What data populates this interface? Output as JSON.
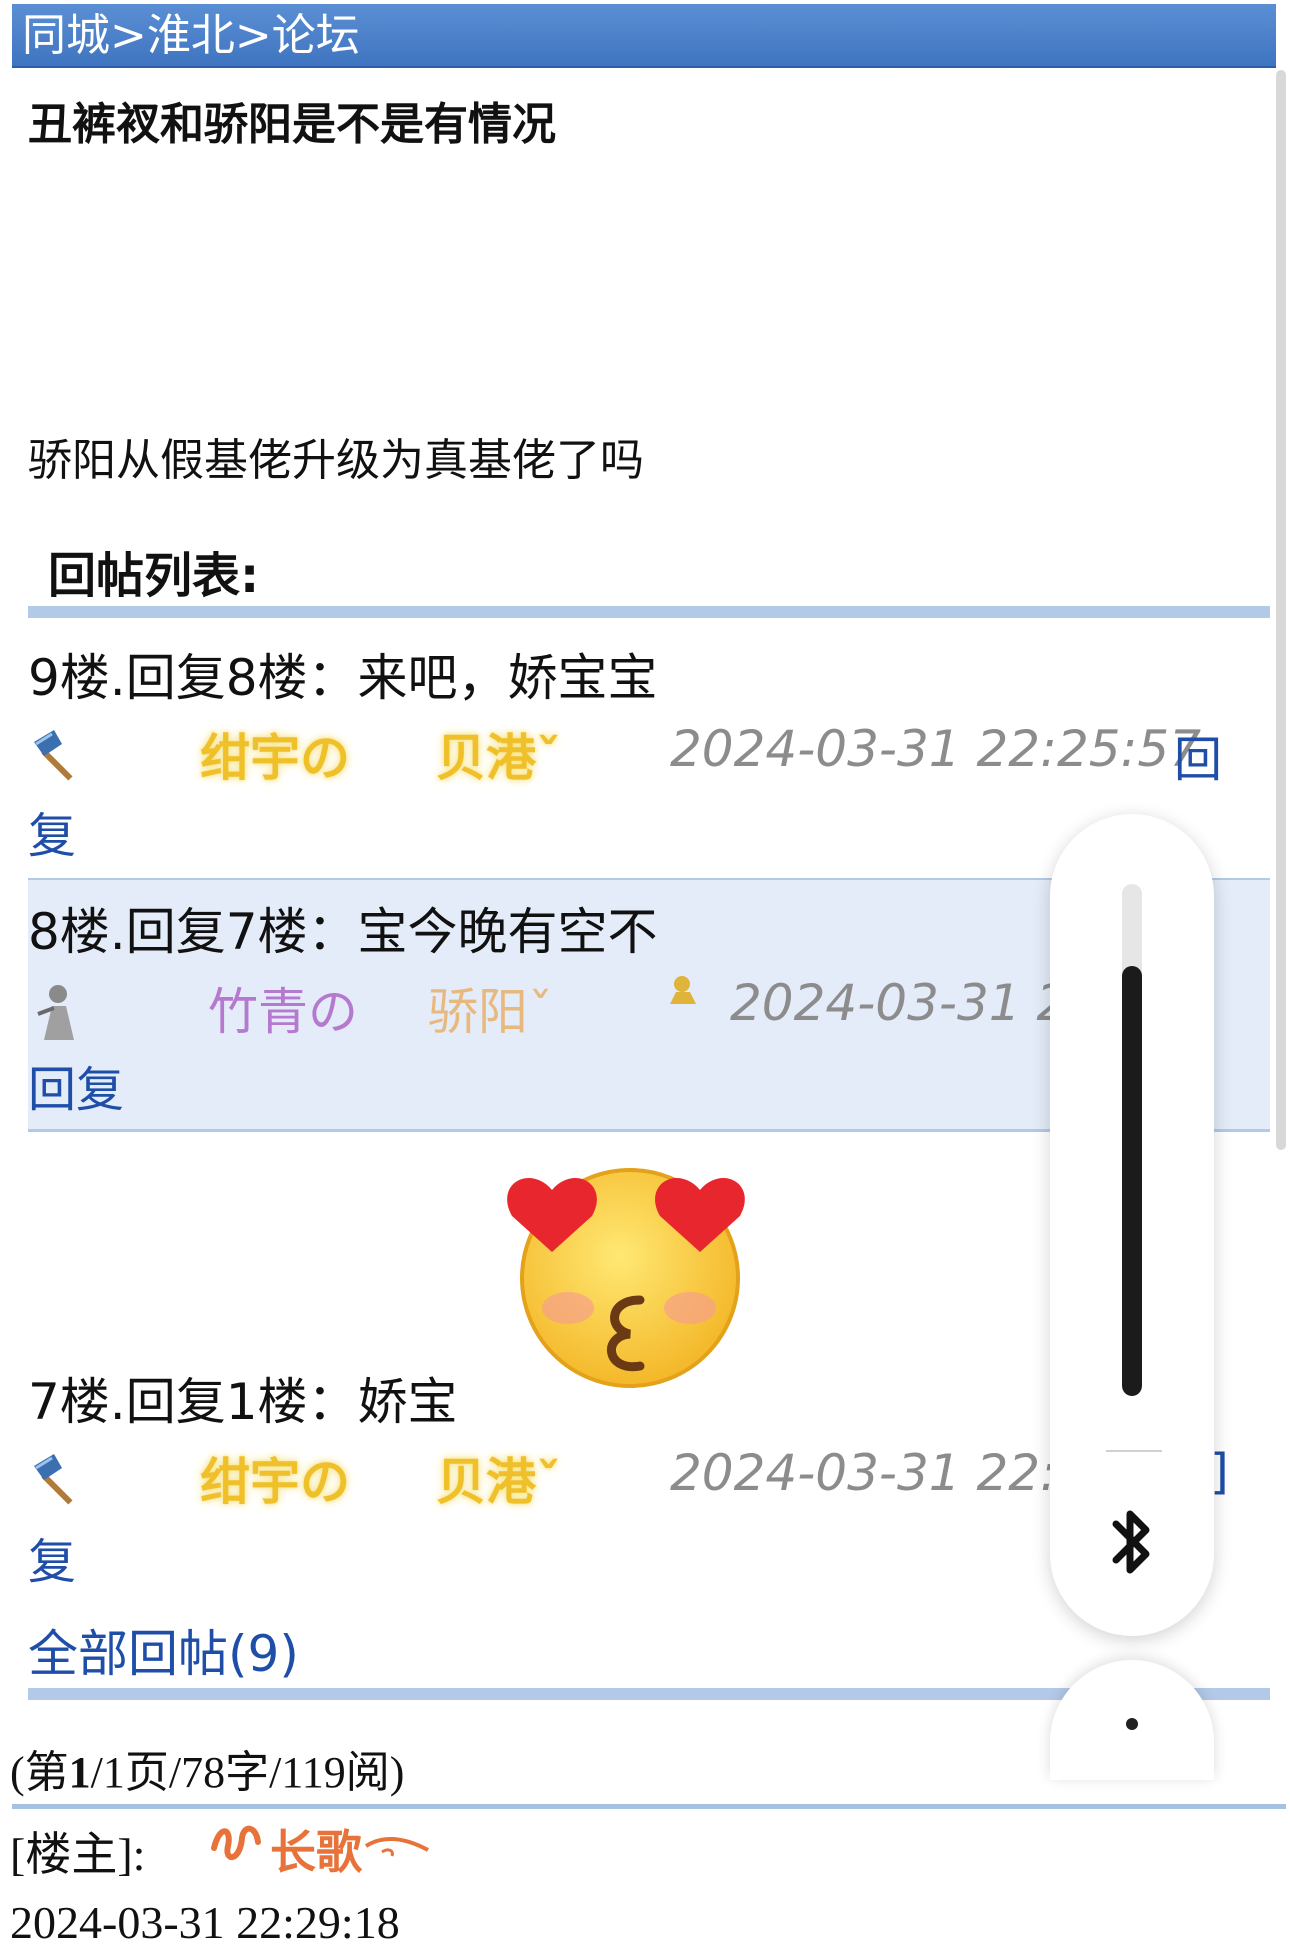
{
  "breadcrumb": {
    "part1": "同城",
    "sep1": ">",
    "part2": "淮北",
    "sep2": ">",
    "part3": "论坛"
  },
  "post": {
    "title": "丑裤衩和骄阳是不是有情况",
    "body": "骄阳从假基佬升级为真基佬了吗"
  },
  "replies_heading": "回帖列表:",
  "replies": [
    {
      "text": "9楼.回复8楼：来吧，娇宝宝",
      "avatar_icon": "axe-icon",
      "user_a": "绀宇の",
      "user_b": "贝港ˇ",
      "time": "2024-03-31 22:25:57",
      "reply_label_1": "回",
      "reply_label_2": "复"
    },
    {
      "text": "8楼.回复7楼：宝今晚有空不",
      "avatar_icon": "figure-icon",
      "user_a": "竹青の",
      "user_b": "骄阳ˇ",
      "badge_icon": "user-badge-icon",
      "time": "2024-03-31 22",
      "reply_label": "回复"
    },
    {
      "text": "7楼.回复1楼：娇宝",
      "avatar_icon": "axe-icon",
      "user_a": "绀宇の",
      "user_b": "贝港ˇ",
      "time": "2024-03-31 22:1",
      "reply_label_1": "]",
      "reply_label_2": "复",
      "emoji": "heart-eyes-kiss-emoji"
    }
  ],
  "all_replies": "全部回帖(9)",
  "page_info": {
    "prefix": "(第",
    "current": "1",
    "rest": "/1页/78字/119阅)"
  },
  "owner": {
    "label": "[楼主]:",
    "name": "长歌",
    "time": "2024-03-31 22:29:18"
  },
  "volume_panel": {
    "level": 0.84,
    "icon": "bluetooth-icon"
  },
  "colors": {
    "header": "#4a80c8",
    "link": "#1f4ea8",
    "gold_name": "#f0c02a",
    "purple_name": "#b57ad0",
    "owner_name": "#e8733a"
  }
}
